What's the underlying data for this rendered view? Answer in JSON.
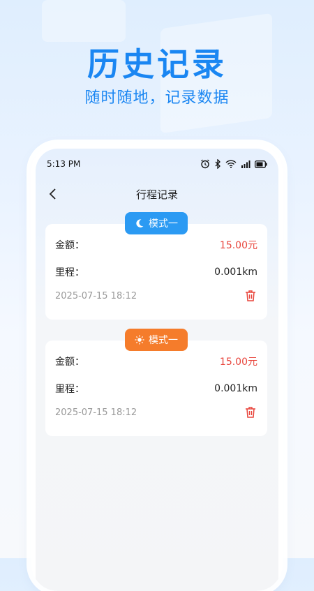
{
  "hero": {
    "title": "历史记录",
    "subtitle": "随时随地，记录数据"
  },
  "status_bar": {
    "time": "5:13 PM",
    "icons": [
      "alarm-icon",
      "bluetooth-icon",
      "wifi-icon",
      "signal-icon",
      "battery-icon"
    ]
  },
  "nav": {
    "title": "行程记录",
    "back_icon": "chevron-left-icon"
  },
  "records": [
    {
      "mode_label": "模式一",
      "mode_icon": "moon-icon",
      "badge_color": "#2b9af3",
      "amount_label": "金额：",
      "amount_value": "15.00元",
      "distance_label": "里程：",
      "distance_value": "0.001km",
      "datetime": "2025-07-15 18:12"
    },
    {
      "mode_label": "模式一",
      "mode_icon": "sun-icon",
      "badge_color": "#f57c2b",
      "amount_label": "金额：",
      "amount_value": "15.00元",
      "distance_label": "里程：",
      "distance_value": "0.001km",
      "datetime": "2025-07-15 18:12"
    }
  ],
  "colors": {
    "accent": "#1a86f2",
    "amount": "#e8453c",
    "night_badge": "#2b9af3",
    "day_badge": "#f57c2b"
  }
}
